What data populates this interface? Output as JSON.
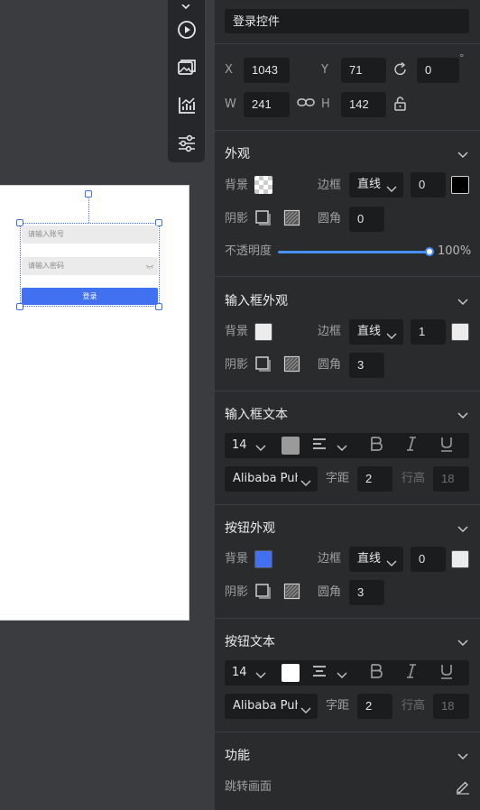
{
  "canvas": {
    "username_placeholder": "请输入账号",
    "password_placeholder": "请输入密码",
    "login_label": "登录"
  },
  "panel": {
    "component_name": "登录控件",
    "degree_symbol": "°",
    "position": {
      "x_label": "X",
      "x": "1043",
      "y_label": "Y",
      "y": "71",
      "rotation": "0"
    },
    "size": {
      "w_label": "W",
      "w": "241",
      "h_label": "H",
      "h": "142"
    },
    "appearance": {
      "title": "外观",
      "bg_label": "背景",
      "border_label": "边框",
      "border_style": "直线",
      "border_width": "0",
      "border_color": "#000000",
      "shadow_label": "阴影",
      "radius_label": "圆角",
      "radius": "0",
      "opacity_label": "不透明度",
      "opacity_value": "100%",
      "opacity": 1.0
    },
    "input_appearance": {
      "title": "输入框外观",
      "bg_label": "背景",
      "bg_color": "#ececec",
      "border_label": "边框",
      "border_style": "直线",
      "border_width": "1",
      "border_color": "#ececec",
      "shadow_label": "阴影",
      "radius_label": "圆角",
      "radius": "3"
    },
    "input_text": {
      "title": "输入框文本",
      "font_size": "14",
      "color": "#9a9a9a",
      "font_family": "Alibaba Puh",
      "letter_spacing_label": "字距",
      "letter_spacing": "2",
      "line_height_label": "行高",
      "line_height": "18"
    },
    "button_appearance": {
      "title": "按钮外观",
      "bg_label": "背景",
      "bg_color": "#4171f0",
      "border_label": "边框",
      "border_style": "直线",
      "border_width": "0",
      "border_color": "#ececec",
      "shadow_label": "阴影",
      "radius_label": "圆角",
      "radius": "3"
    },
    "button_text": {
      "title": "按钮文本",
      "font_size": "14",
      "color": "#ffffff",
      "font_family": "Alibaba Puh",
      "letter_spacing_label": "字距",
      "letter_spacing": "2",
      "line_height_label": "行高",
      "line_height": "18"
    },
    "function": {
      "title": "功能",
      "jump_label": "跳转画面"
    }
  },
  "toolbar_icons": [
    "play-circle-icon",
    "images-icon",
    "chart-icon",
    "sliders-icon"
  ]
}
